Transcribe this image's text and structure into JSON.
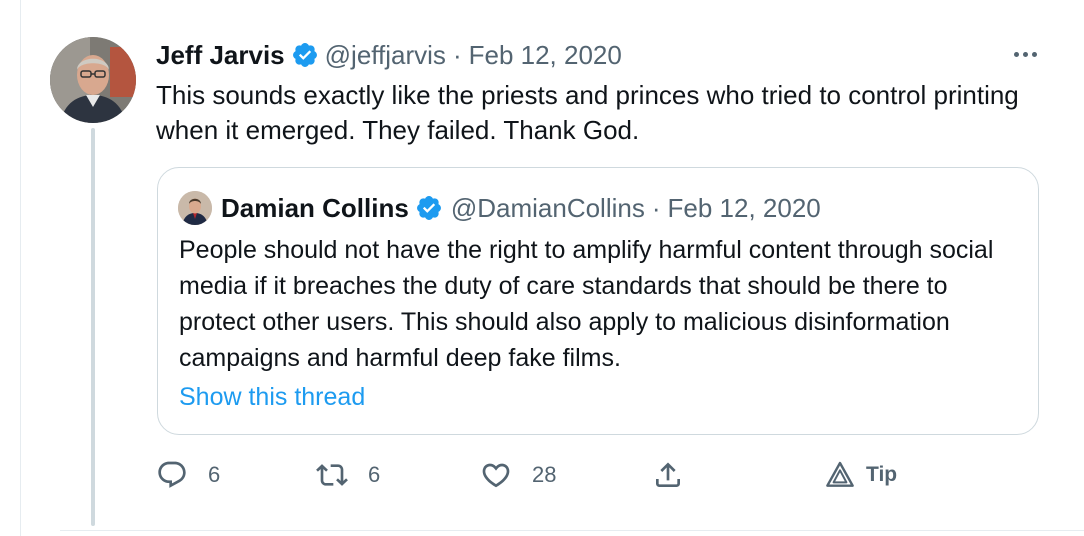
{
  "tweet": {
    "author_name": "Jeff Jarvis",
    "handle": "@jeffjarvis",
    "separator": "·",
    "date": "Feb 12, 2020",
    "text": "This sounds exactly like the priests and princes who tried to control printing when it emerged. They failed. Thank God."
  },
  "quoted_tweet": {
    "author_name": "Damian Collins",
    "handle": "@DamianCollins",
    "separator": "·",
    "date": "Feb 12, 2020",
    "text": "People should not have the right to amplify harmful content through social media if it breaches the duty of care standards that should be there to protect other users. This should also apply to malicious disinformation campaigns and harmful deep fake films.",
    "show_thread_label": "Show this thread"
  },
  "actions": {
    "reply_count": "6",
    "retweet_count": "6",
    "like_count": "28",
    "tip_label": "Tip"
  },
  "icons": {
    "verified": "verified-badge-icon",
    "more": "more-options-icon",
    "reply": "reply-icon",
    "retweet": "retweet-icon",
    "like": "heart-icon",
    "share": "share-icon",
    "tip": "tip-icon"
  },
  "colors": {
    "text": "#0f1419",
    "secondary": "#536471",
    "accent": "#1d9bf0",
    "border": "#cfd9de"
  }
}
